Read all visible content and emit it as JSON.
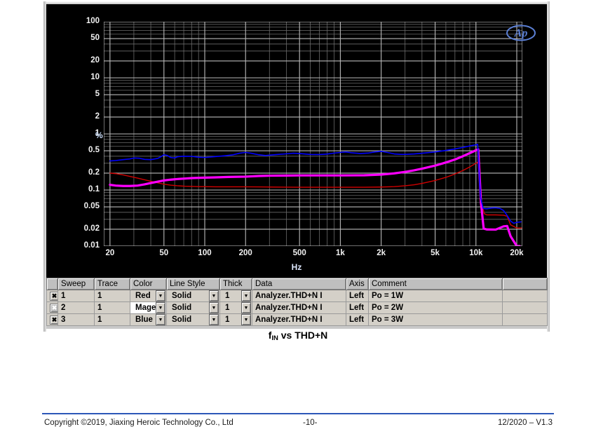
{
  "chart_data": {
    "type": "line",
    "title": "fIN vs THD+N",
    "xlabel": "Hz",
    "ylabel": "%",
    "xscale": "log",
    "yscale": "log",
    "xlim": [
      18,
      22000
    ],
    "ylim": [
      0.01,
      100
    ],
    "grid": true,
    "xticks": [
      "20",
      "50",
      "100",
      "200",
      "500",
      "1k",
      "2k",
      "5k",
      "10k",
      "20k"
    ],
    "xtick_values": [
      20,
      50,
      100,
      200,
      500,
      1000,
      2000,
      5000,
      10000,
      20000
    ],
    "yticks": [
      "100",
      "50",
      "20",
      "10",
      "5",
      "2",
      "1",
      "0.5",
      "0.2",
      "0.1",
      "0.05",
      "0.02",
      "0.01"
    ],
    "ytick_values": [
      100,
      50,
      20,
      10,
      5,
      2,
      1,
      0.5,
      0.2,
      0.1,
      0.05,
      0.02,
      0.01
    ],
    "watermark": "Ap",
    "series": [
      {
        "name": "Po = 1W",
        "color": "#d00000",
        "width": 1.4,
        "points": [
          [
            20,
            0.2
          ],
          [
            22,
            0.196
          ],
          [
            25,
            0.186
          ],
          [
            28,
            0.175
          ],
          [
            32,
            0.163
          ],
          [
            36,
            0.152
          ],
          [
            40,
            0.143
          ],
          [
            45,
            0.134
          ],
          [
            50,
            0.127
          ],
          [
            56,
            0.122
          ],
          [
            63,
            0.119
          ],
          [
            71,
            0.117
          ],
          [
            80,
            0.116
          ],
          [
            90,
            0.115
          ],
          [
            100,
            0.115
          ],
          [
            120,
            0.114
          ],
          [
            150,
            0.114
          ],
          [
            200,
            0.114
          ],
          [
            250,
            0.1135
          ],
          [
            300,
            0.113
          ],
          [
            400,
            0.1125
          ],
          [
            500,
            0.112
          ],
          [
            700,
            0.112
          ],
          [
            1000,
            0.112
          ],
          [
            1500,
            0.112
          ],
          [
            2000,
            0.113
          ],
          [
            2500,
            0.115
          ],
          [
            3000,
            0.119
          ],
          [
            3500,
            0.124
          ],
          [
            4000,
            0.131
          ],
          [
            5000,
            0.148
          ],
          [
            6000,
            0.168
          ],
          [
            7000,
            0.193
          ],
          [
            8000,
            0.222
          ],
          [
            9000,
            0.258
          ],
          [
            10000,
            0.3
          ],
          [
            10500,
            0.32
          ],
          [
            11000,
            0.06
          ],
          [
            11500,
            0.038
          ],
          [
            12000,
            0.036
          ],
          [
            14000,
            0.036
          ],
          [
            16000,
            0.0355
          ],
          [
            17000,
            0.034
          ],
          [
            18000,
            0.024
          ],
          [
            20000,
            0.021
          ],
          [
            22000,
            0.021
          ]
        ]
      },
      {
        "name": "Po = 2W",
        "color": "#ff00ff",
        "width": 3.2,
        "points": [
          [
            20,
            0.124
          ],
          [
            22,
            0.12
          ],
          [
            25,
            0.118
          ],
          [
            28,
            0.118
          ],
          [
            32,
            0.12
          ],
          [
            36,
            0.126
          ],
          [
            40,
            0.133
          ],
          [
            45,
            0.141
          ],
          [
            50,
            0.148
          ],
          [
            56,
            0.153
          ],
          [
            63,
            0.157
          ],
          [
            71,
            0.16
          ],
          [
            80,
            0.163
          ],
          [
            90,
            0.165
          ],
          [
            100,
            0.166
          ],
          [
            120,
            0.168
          ],
          [
            150,
            0.171
          ],
          [
            200,
            0.173
          ],
          [
            250,
            0.178
          ],
          [
            300,
            0.18
          ],
          [
            400,
            0.181
          ],
          [
            500,
            0.182
          ],
          [
            700,
            0.182
          ],
          [
            1000,
            0.182
          ],
          [
            1500,
            0.183
          ],
          [
            2000,
            0.188
          ],
          [
            2500,
            0.198
          ],
          [
            3000,
            0.21
          ],
          [
            3500,
            0.224
          ],
          [
            4000,
            0.24
          ],
          [
            5000,
            0.272
          ],
          [
            6000,
            0.31
          ],
          [
            7000,
            0.35
          ],
          [
            8000,
            0.4
          ],
          [
            9000,
            0.455
          ],
          [
            10000,
            0.51
          ],
          [
            10400,
            0.53
          ],
          [
            10900,
            0.058
          ],
          [
            11400,
            0.0205
          ],
          [
            12000,
            0.0198
          ],
          [
            14000,
            0.0197
          ],
          [
            16000,
            0.0225
          ],
          [
            17000,
            0.0228
          ],
          [
            18000,
            0.015
          ],
          [
            20000,
            0.01
          ],
          [
            21000,
            0.0085
          ]
        ]
      },
      {
        "name": "Po = 3W",
        "color": "#0000ff",
        "width": 1.6,
        "points": [
          [
            20,
            0.33
          ],
          [
            22,
            0.335
          ],
          [
            25,
            0.348
          ],
          [
            28,
            0.358
          ],
          [
            30,
            0.372
          ],
          [
            33,
            0.368
          ],
          [
            36,
            0.352
          ],
          [
            40,
            0.348
          ],
          [
            45,
            0.366
          ],
          [
            48,
            0.398
          ],
          [
            50,
            0.425
          ],
          [
            53,
            0.412
          ],
          [
            56,
            0.38
          ],
          [
            60,
            0.372
          ],
          [
            63,
            0.392
          ],
          [
            70,
            0.4
          ],
          [
            80,
            0.398
          ],
          [
            90,
            0.385
          ],
          [
            100,
            0.38
          ],
          [
            120,
            0.395
          ],
          [
            140,
            0.408
          ],
          [
            160,
            0.422
          ],
          [
            180,
            0.452
          ],
          [
            200,
            0.468
          ],
          [
            220,
            0.452
          ],
          [
            250,
            0.425
          ],
          [
            280,
            0.412
          ],
          [
            300,
            0.418
          ],
          [
            350,
            0.432
          ],
          [
            400,
            0.442
          ],
          [
            450,
            0.452
          ],
          [
            500,
            0.448
          ],
          [
            600,
            0.43
          ],
          [
            700,
            0.428
          ],
          [
            800,
            0.438
          ],
          [
            900,
            0.455
          ],
          [
            1000,
            0.468
          ],
          [
            1100,
            0.478
          ],
          [
            1200,
            0.462
          ],
          [
            1400,
            0.448
          ],
          [
            1600,
            0.455
          ],
          [
            1800,
            0.478
          ],
          [
            2000,
            0.49
          ],
          [
            2200,
            0.47
          ],
          [
            2500,
            0.44
          ],
          [
            2800,
            0.432
          ],
          [
            3000,
            0.432
          ],
          [
            3500,
            0.44
          ],
          [
            4000,
            0.452
          ],
          [
            5000,
            0.478
          ],
          [
            6000,
            0.508
          ],
          [
            7000,
            0.54
          ],
          [
            8000,
            0.575
          ],
          [
            9000,
            0.61
          ],
          [
            10000,
            0.64
          ],
          [
            10300,
            0.655
          ],
          [
            10800,
            0.075
          ],
          [
            11300,
            0.047
          ],
          [
            12000,
            0.0462
          ],
          [
            13000,
            0.0478
          ],
          [
            14000,
            0.0482
          ],
          [
            15000,
            0.047
          ],
          [
            16000,
            0.043
          ],
          [
            17000,
            0.035
          ],
          [
            18000,
            0.028
          ],
          [
            19000,
            0.0255
          ],
          [
            20000,
            0.0265
          ],
          [
            21500,
            0.027
          ]
        ]
      }
    ]
  },
  "legend_table": {
    "columns": [
      "",
      "Sweep",
      "Trace",
      "Color",
      "Line Style",
      "Thick",
      "Data",
      "Axis",
      "Comment",
      ""
    ],
    "rows": [
      {
        "enabled_mark": "✖",
        "sweep": "1",
        "trace": "1",
        "color": "Red",
        "line_style": "Solid",
        "thick": "1",
        "data": "Analyzer.THD+N I",
        "axis": "Left",
        "comment": "Po = 1W",
        "selected": false
      },
      {
        "enabled_mark": "✖",
        "sweep": "2",
        "trace": "1",
        "color": "Magen",
        "line_style": "Solid",
        "thick": "1",
        "data": "Analyzer.THD+N I",
        "axis": "Left",
        "comment": "Po = 2W",
        "selected": true
      },
      {
        "enabled_mark": "✖",
        "sweep": "3",
        "trace": "1",
        "color": "Blue",
        "line_style": "Solid",
        "thick": "1",
        "data": "Analyzer.THD+N I",
        "axis": "Left",
        "comment": "Po = 3W",
        "selected": false
      }
    ],
    "dropdown_glyph": "▼"
  },
  "figure_caption": {
    "prefix": "f",
    "subscript": "IN",
    "suffix": " vs THD+N"
  },
  "footer": {
    "copyright": "Copyright ©2019, Jiaxing Heroic Technology Co., Ltd",
    "page": "-10-",
    "version": "12/2020 – V1.3",
    "rule_color": "#2d57b8"
  }
}
